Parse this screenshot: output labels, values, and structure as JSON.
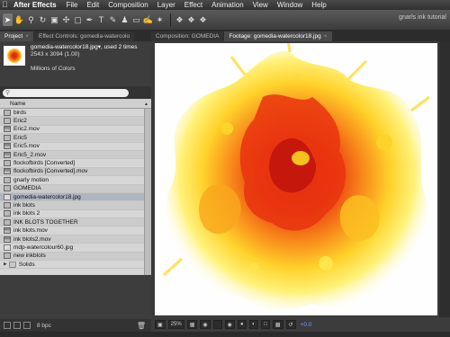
{
  "menubar": {
    "apple": "",
    "app": "After Effects",
    "items": [
      "File",
      "Edit",
      "Composition",
      "Layer",
      "Effect",
      "Animation",
      "View",
      "Window",
      "Help"
    ]
  },
  "toolbar": {
    "workspace_label": "gnarls ink tutorial"
  },
  "project_panel": {
    "tab_project": "Project",
    "tab_effect_controls": "Effect Controls: gomedia-watercolo",
    "info_name": "gomedia-watercolor18.jpg▾, used 2 times",
    "info_size": "2543 x 3094 (1.00)",
    "info_colors": "Millions of Colors",
    "search_placeholder": "",
    "column_name": "Name",
    "items": [
      {
        "name": "birds",
        "icon": "comp"
      },
      {
        "name": "Eric2",
        "icon": "comp"
      },
      {
        "name": "Eric2.mov",
        "icon": "footage"
      },
      {
        "name": "Eric5",
        "icon": "comp"
      },
      {
        "name": "Eric5.mov",
        "icon": "footage"
      },
      {
        "name": "Eric5_2.mov",
        "icon": "footage"
      },
      {
        "name": "flockofbirds [Converted]",
        "icon": "comp"
      },
      {
        "name": "flockofbirds [Converted].mov",
        "icon": "footage"
      },
      {
        "name": "gnarly motion",
        "icon": "comp"
      },
      {
        "name": "GOMEDIA",
        "icon": "comp"
      },
      {
        "name": "gomedia-watercolor18.jpg",
        "icon": "still",
        "selected": true
      },
      {
        "name": "ink blots",
        "icon": "comp"
      },
      {
        "name": "ink blots 2",
        "icon": "comp"
      },
      {
        "name": "INK BLOTS TOGETHER",
        "icon": "comp"
      },
      {
        "name": "ink blots.mov",
        "icon": "footage"
      },
      {
        "name": "ink blots2.mov",
        "icon": "footage"
      },
      {
        "name": "mdp-watercolour60.jpg",
        "icon": "still"
      },
      {
        "name": "new inkblots",
        "icon": "comp"
      },
      {
        "name": "Solids",
        "icon": "folder"
      }
    ],
    "bpc_label": "8 bpc"
  },
  "viewer": {
    "tab_composition": "Composition: GOMEDIA",
    "tab_footage": "Footage: gomedia-watercolor18.jpg",
    "zoom": "25%",
    "exposure": "+0.0"
  },
  "bottom_tabs": [
    "",
    "",
    ""
  ]
}
